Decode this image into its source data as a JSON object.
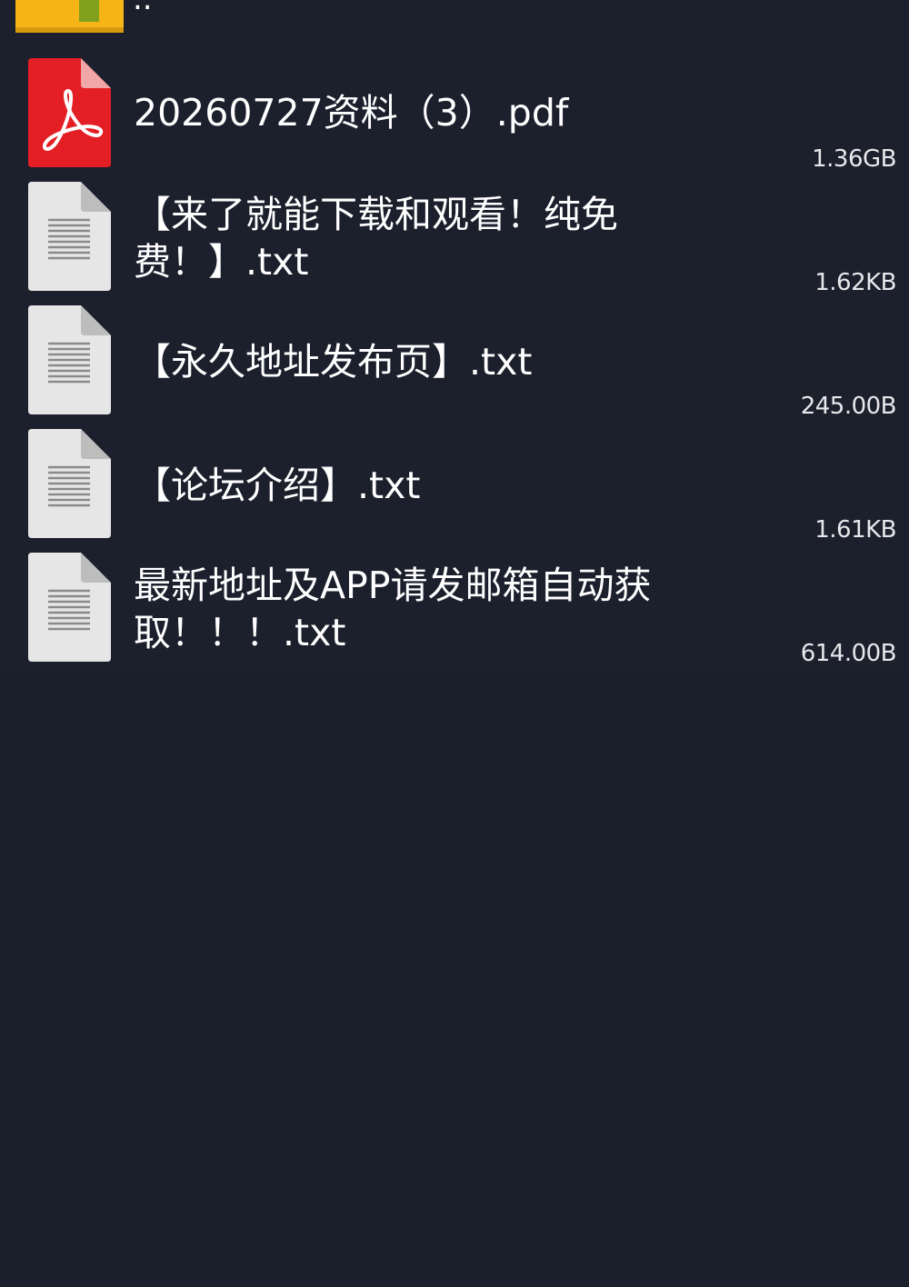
{
  "colors": {
    "background": "#1b1e2b",
    "folder": "#f6b417",
    "folder_accent": "#7fa11b",
    "pdf_red": "#e31e24",
    "doc_gray": "#e6e6e6"
  },
  "parent_entry": {
    "label": "..",
    "icon": "folder-icon"
  },
  "files": [
    {
      "name": "20260727资料（3）.pdf",
      "size": "1.36GB",
      "icon": "pdf-icon"
    },
    {
      "name": "【来了就能下载和观看！纯免费！】.txt",
      "size": "1.62KB",
      "icon": "text-file-icon"
    },
    {
      "name": "【永久地址发布页】.txt",
      "size": "245.00B",
      "icon": "text-file-icon"
    },
    {
      "name": "【论坛介绍】.txt",
      "size": "1.61KB",
      "icon": "text-file-icon"
    },
    {
      "name": "最新地址及APP请发邮箱自动获取！！！.txt",
      "size": "614.00B",
      "icon": "text-file-icon"
    }
  ]
}
